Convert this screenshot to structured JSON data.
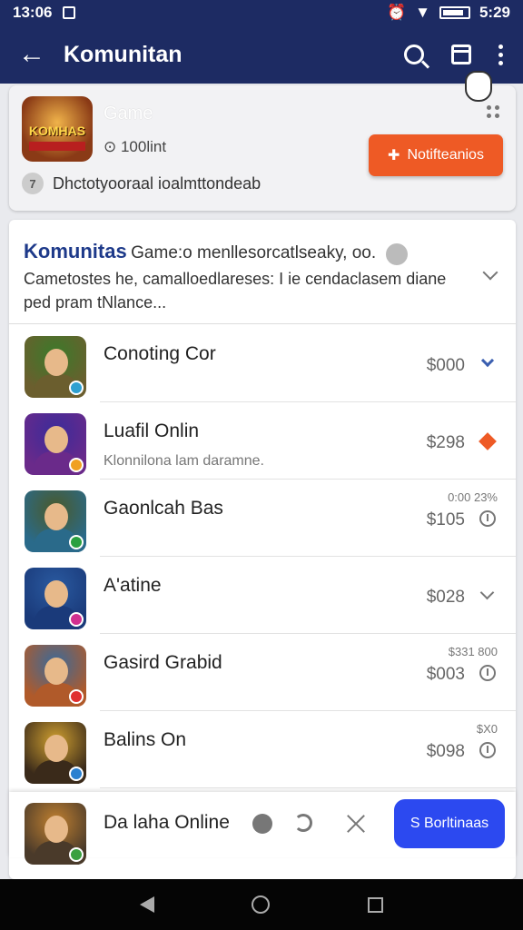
{
  "status_bar": {
    "time": "13:06",
    "clock": "5:29"
  },
  "app_bar": {
    "title": "Komunitan"
  },
  "game": {
    "logo_text": "KOMHAS",
    "title": "Game",
    "members": "⊙ 100lint",
    "notify_label": "Notifteanios",
    "info_badge": "7",
    "info_text": "Dhctotyooraal ioalmttondeab"
  },
  "community": {
    "title": "Komunitas",
    "subtitle": "Game:o menllesorcatlseaky, oo.",
    "description": "Cametostes he, camalloedlareses: I ie cendaclasem diane ped pram tNlance..."
  },
  "rows": [
    {
      "name": "Conoting Cor",
      "price": "$000",
      "subtext": "",
      "stat": "",
      "action": "check-icon",
      "colors": [
        "#6b5e2e",
        "#3b7a2a",
        "#2ea0d0"
      ]
    },
    {
      "name": "Luafil Onlin",
      "price": "$298",
      "subtext": "Klonnilona lam daramne.",
      "stat": "",
      "action": "diamond-icon",
      "colors": [
        "#6a2a8a",
        "#3b2b9a",
        "#f0a020"
      ]
    },
    {
      "name": "Gaonlcah Bas",
      "price": "$105",
      "subtext": "",
      "stat": "0:00  23%",
      "action": "pin-icon",
      "colors": [
        "#2a6a8a",
        "#4a5a2a",
        "#2aa040"
      ]
    },
    {
      "name": "A'atine",
      "price": "$028",
      "subtext": "",
      "stat": "",
      "action": "chevron-icon",
      "colors": [
        "#1a3a7a",
        "#2a5aa0",
        "#d03090"
      ]
    },
    {
      "name": "Gasird Grabid",
      "price": "$003",
      "subtext": "",
      "stat": "$331 800",
      "action": "pin-icon",
      "colors": [
        "#b05a2a",
        "#3a6a9a",
        "#e03030"
      ]
    },
    {
      "name": "Balins On",
      "price": "$098",
      "subtext": "",
      "stat": "$X0",
      "action": "pin-icon",
      "colors": [
        "#3a2a1a",
        "#d0a030",
        "#2a80d0"
      ]
    }
  ],
  "bottom_row": {
    "name": "Da laha Online",
    "button_label": "S Borltinaas",
    "colors": [
      "#4a3a2a",
      "#c08030",
      "#3aa040"
    ]
  }
}
